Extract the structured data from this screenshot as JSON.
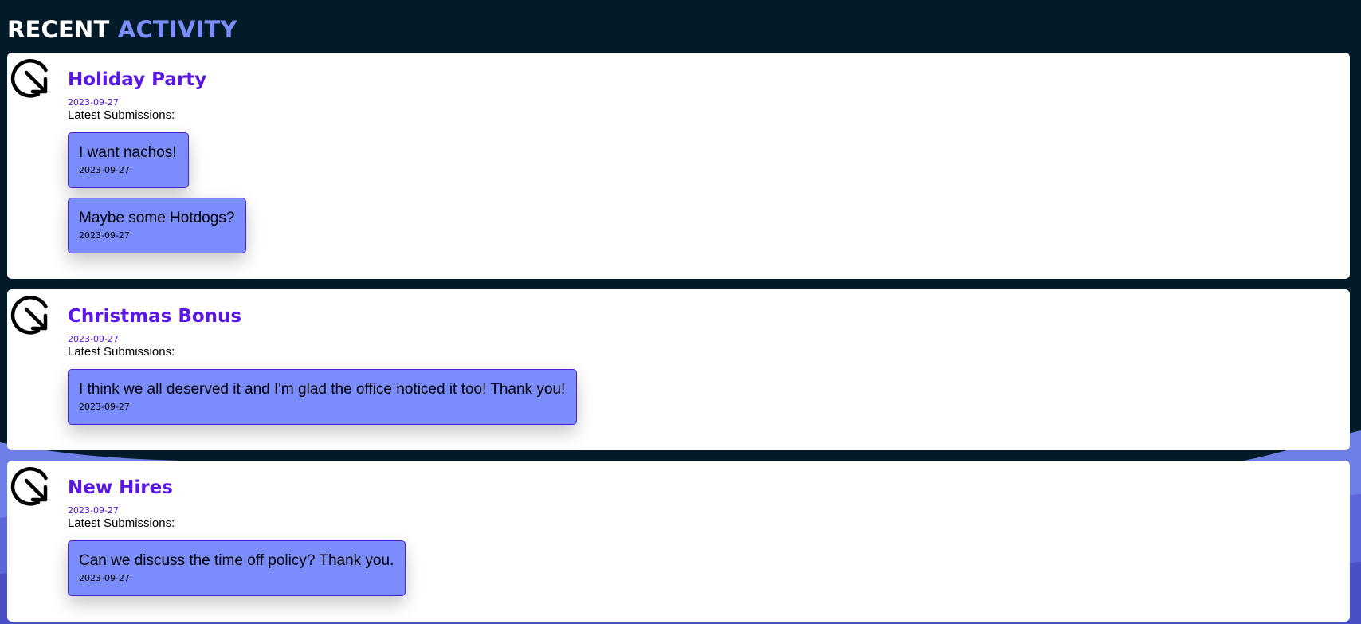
{
  "header": {
    "title_part1": "RECENT",
    "title_part2": "ACTIVITY"
  },
  "icons": {
    "activity": "circle-arrow-down-right-icon"
  },
  "colors": {
    "background": "#031a28",
    "accent": "#7b8ffc",
    "title": "#5a16e6",
    "submission_bg": "#7b8dfd",
    "submission_border": "#4a20d6"
  },
  "activities": [
    {
      "title": "Holiday Party",
      "date": "2023-09-27",
      "submissions_label": "Latest Submissions:",
      "submissions": [
        {
          "text": "I want nachos!",
          "date": "2023-09-27"
        },
        {
          "text": "Maybe some Hotdogs?",
          "date": "2023-09-27"
        }
      ]
    },
    {
      "title": "Christmas Bonus",
      "date": "2023-09-27",
      "submissions_label": "Latest Submissions:",
      "submissions": [
        {
          "text": "I think we all deserved it and I'm glad the office noticed it too! Thank you!",
          "date": "2023-09-27"
        }
      ]
    },
    {
      "title": "New Hires",
      "date": "2023-09-27",
      "submissions_label": "Latest Submissions:",
      "submissions": [
        {
          "text": "Can we discuss the time off policy? Thank you.",
          "date": "2023-09-27"
        }
      ]
    }
  ]
}
